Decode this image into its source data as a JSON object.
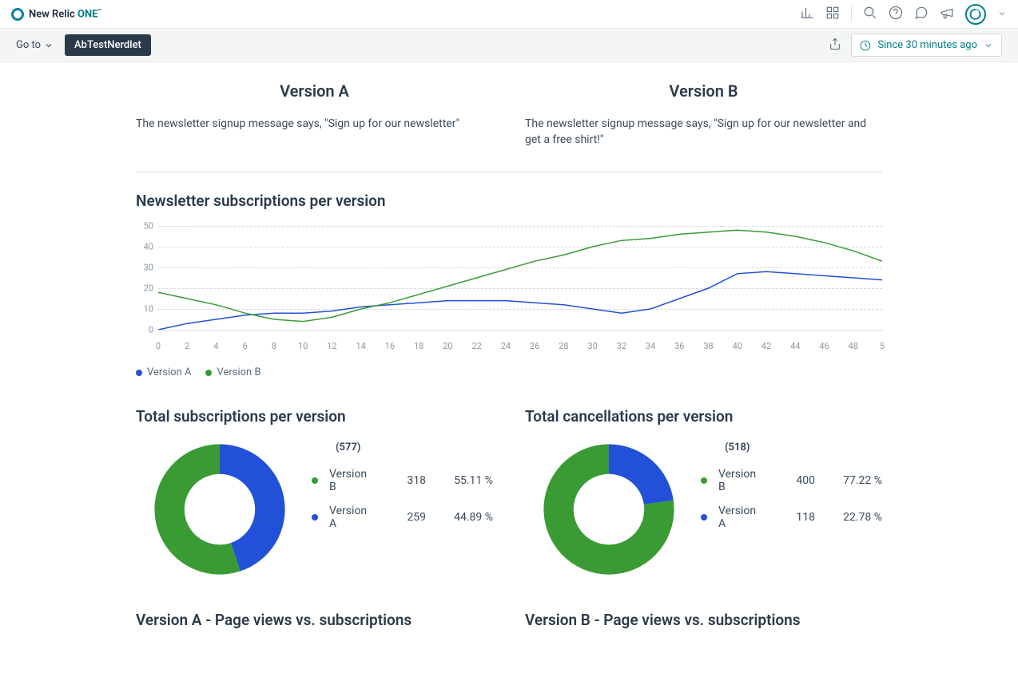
{
  "brand": {
    "text1": "New Relic ",
    "text2": "ONE",
    "tm": "™"
  },
  "subbar": {
    "goto": "Go to",
    "chip": "AbTestNerdlet",
    "time": "Since 30 minutes ago"
  },
  "versions": {
    "a": {
      "title": "Version A",
      "desc": "The newsletter signup message says, \"Sign up for our newsletter\""
    },
    "b": {
      "title": "Version B",
      "desc": "The newsletter signup message says, \"Sign up for our newsletter and get a free shirt!\""
    }
  },
  "lineChart": {
    "title": "Newsletter subscriptions per version",
    "legendA": "Version A",
    "legendB": "Version B"
  },
  "donut1": {
    "title": "Total subscriptions per version",
    "total": "(577)",
    "rows": [
      {
        "label": "Version B",
        "val": "318",
        "pct": "55.11 %",
        "color": "#3a9b35"
      },
      {
        "label": "Version A",
        "val": "259",
        "pct": "44.89 %",
        "color": "#2250d8"
      }
    ]
  },
  "donut2": {
    "title": "Total cancellations per version",
    "total": "(518)",
    "rows": [
      {
        "label": "Version B",
        "val": "400",
        "pct": "77.22 %",
        "color": "#3a9b35"
      },
      {
        "label": "Version A",
        "val": "118",
        "pct": "22.78 %",
        "color": "#2250d8"
      }
    ]
  },
  "bottom": {
    "a": "Version A - Page views vs. subscriptions",
    "b": "Version B - Page views vs. subscriptions"
  },
  "colors": {
    "green": "#3a9b35",
    "blue": "#2250d8"
  },
  "chart_data": [
    {
      "type": "line",
      "title": "Newsletter subscriptions per version",
      "xlabel": "",
      "ylabel": "",
      "ylim": [
        0,
        50
      ],
      "x_ticks": [
        "0",
        "2",
        "4",
        "6",
        "8",
        "10",
        "12",
        "14",
        "16",
        "18",
        "20",
        "22",
        "24",
        "26",
        "28",
        "30",
        "32",
        "34",
        "36",
        "38",
        "40",
        "42",
        "44",
        "46",
        "48",
        "5"
      ],
      "y_ticks": [
        0,
        10,
        20,
        30,
        40,
        50
      ],
      "series": [
        {
          "name": "Version A",
          "color": "#2250d8",
          "values": [
            0,
            3,
            5,
            7,
            8,
            8,
            9,
            11,
            12,
            13,
            14,
            14,
            14,
            13,
            12,
            10,
            8,
            10,
            15,
            20,
            27,
            28,
            27,
            26,
            25,
            24
          ]
        },
        {
          "name": "Version B",
          "color": "#3a9b35",
          "values": [
            18,
            15,
            12,
            8,
            5,
            4,
            6,
            10,
            13,
            17,
            21,
            25,
            29,
            33,
            36,
            40,
            43,
            44,
            46,
            47,
            48,
            47,
            45,
            42,
            38,
            33
          ]
        }
      ]
    },
    {
      "type": "pie",
      "title": "Total subscriptions per version",
      "total": 577,
      "series": [
        {
          "name": "Version B",
          "value": 318,
          "pct": 55.11,
          "color": "#3a9b35"
        },
        {
          "name": "Version A",
          "value": 259,
          "pct": 44.89,
          "color": "#2250d8"
        }
      ]
    },
    {
      "type": "pie",
      "title": "Total cancellations per version",
      "total": 518,
      "series": [
        {
          "name": "Version B",
          "value": 400,
          "pct": 77.22,
          "color": "#3a9b35"
        },
        {
          "name": "Version A",
          "value": 118,
          "pct": 22.78,
          "color": "#2250d8"
        }
      ]
    }
  ]
}
